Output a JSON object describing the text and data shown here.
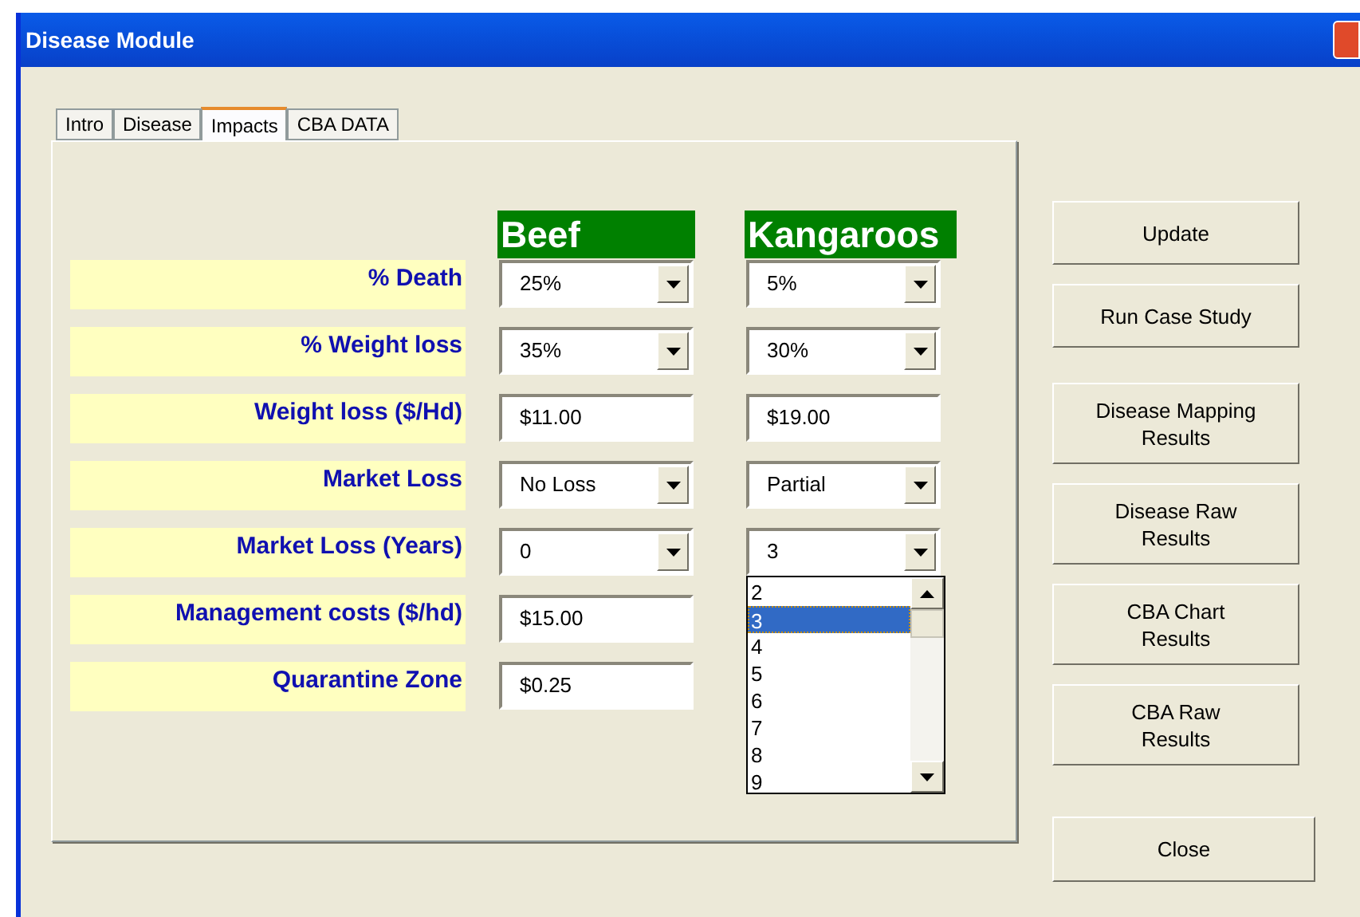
{
  "window": {
    "title": "Disease Module"
  },
  "tabs": [
    {
      "label": "Intro",
      "selected": false
    },
    {
      "label": "Disease",
      "selected": false
    },
    {
      "label": "Impacts",
      "selected": true
    },
    {
      "label": "CBA DATA",
      "selected": false
    }
  ],
  "columns": [
    {
      "header": "Beef"
    },
    {
      "header": "Kangaroos"
    }
  ],
  "rows": [
    {
      "label": "% Death",
      "cells": [
        {
          "kind": "dropdown",
          "value": "25%"
        },
        {
          "kind": "dropdown",
          "value": "5%"
        }
      ]
    },
    {
      "label": "% Weight loss",
      "cells": [
        {
          "kind": "dropdown",
          "value": "35%"
        },
        {
          "kind": "dropdown",
          "value": "30%"
        }
      ]
    },
    {
      "label": "Weight loss ($/Hd)",
      "cells": [
        {
          "kind": "text",
          "value": "$11.00"
        },
        {
          "kind": "text",
          "value": "$19.00"
        }
      ]
    },
    {
      "label": "Market Loss",
      "cells": [
        {
          "kind": "dropdown",
          "value": "No Loss"
        },
        {
          "kind": "dropdown",
          "value": "Partial"
        }
      ]
    },
    {
      "label": "Market Loss (Years)",
      "cells": [
        {
          "kind": "dropdown",
          "value": "0"
        },
        {
          "kind": "dropdown",
          "value": "3",
          "expanded": true,
          "options": [
            {
              "label": "2",
              "selected": false
            },
            {
              "label": "3",
              "selected": true
            },
            {
              "label": "4",
              "selected": false
            },
            {
              "label": "5",
              "selected": false
            },
            {
              "label": "6",
              "selected": false
            },
            {
              "label": "7",
              "selected": false
            },
            {
              "label": "8",
              "selected": false
            },
            {
              "label": "9",
              "selected": false
            }
          ]
        }
      ]
    },
    {
      "label": "Management costs ($/hd)",
      "cells": [
        {
          "kind": "text",
          "value": "$15.00"
        }
      ]
    },
    {
      "label": "Quarantine Zone",
      "cells": [
        {
          "kind": "text",
          "value": "$0.25"
        }
      ]
    }
  ],
  "buttons": [
    {
      "lines": [
        "Update"
      ]
    },
    {
      "lines": [
        "Run Case Study"
      ]
    },
    {
      "lines": [
        "Disease Mapping",
        "Results"
      ]
    },
    {
      "lines": [
        "Disease Raw",
        "Results"
      ]
    },
    {
      "lines": [
        "CBA Chart",
        "Results"
      ]
    },
    {
      "lines": [
        "CBA Raw",
        "Results"
      ]
    }
  ],
  "close_button": {
    "label": "Close"
  }
}
